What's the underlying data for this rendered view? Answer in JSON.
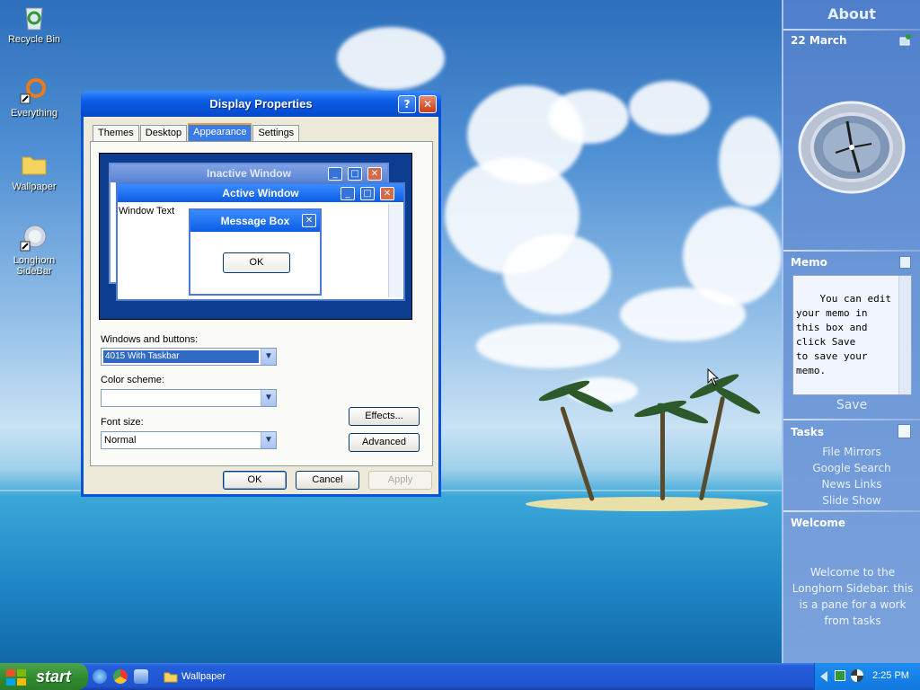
{
  "desktop": {
    "icons": [
      {
        "label": "Recycle Bin",
        "icon": "recycle-bin-icon"
      },
      {
        "label": "Everything",
        "icon": "everything-search-icon"
      },
      {
        "label": "Wallpaper",
        "icon": "folder-icon"
      },
      {
        "label": "Longhorn SideBar",
        "icon": "sidebar-app-icon"
      }
    ]
  },
  "dialog": {
    "title": "Display Properties",
    "help": "?",
    "close": "✕",
    "tabs": [
      "Themes",
      "Desktop",
      "Appearance",
      "Settings"
    ],
    "active_tab": "Appearance",
    "preview": {
      "inactive_title": "Inactive Window",
      "active_title": "Active Window",
      "window_text": "Window Text",
      "message_title": "Message Box",
      "ok": "OK"
    },
    "windows_buttons_label": "Windows and buttons:",
    "windows_buttons_value": "4015 With Taskbar",
    "color_scheme_label": "Color scheme:",
    "color_scheme_value": "",
    "font_size_label": "Font size:",
    "font_size_value": "Normal",
    "effects": "Effects...",
    "advanced": "Advanced",
    "ok": "OK",
    "cancel": "Cancel",
    "apply": "Apply"
  },
  "sidebar": {
    "about": "About",
    "date": "22 March",
    "memo_title": "Memo",
    "memo_text": "You can edit\nyour memo in\nthis box and\nclick Save\nto save your\nmemo.",
    "save": "Save",
    "tasks_title": "Tasks",
    "tasks": [
      "File Mirrors",
      "Google Search",
      "News Links",
      "Slide Show"
    ],
    "welcome_title": "Welcome",
    "welcome_text": "Welcome to the Longhorn Sidebar. this is a pane for a work from tasks"
  },
  "taskbar": {
    "start": "start",
    "task_label": "Wallpaper",
    "clock": "2:25 PM"
  }
}
